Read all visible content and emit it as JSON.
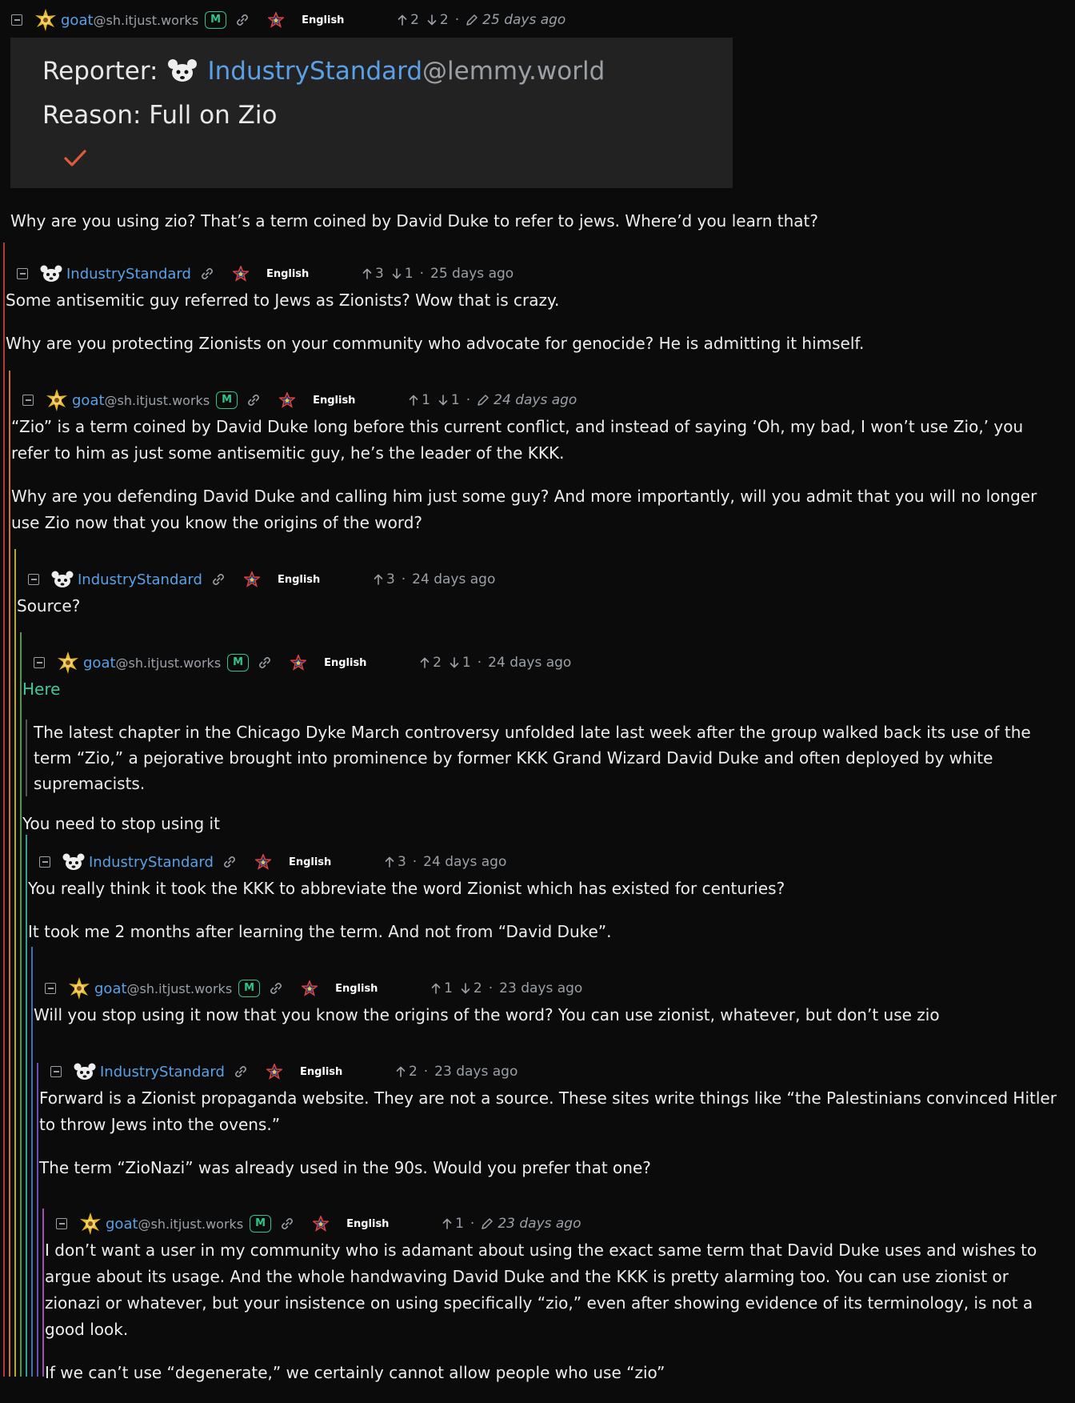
{
  "report": {
    "reporter_label": "Reporter:",
    "reporter_name": "IndustryStandard",
    "reporter_instance": "@lemmy.world",
    "reason": "Reason: Full on Zio"
  },
  "comments": [
    {
      "user": "goat",
      "instance": "@sh.itjust.works",
      "mod": "M",
      "lang": "English",
      "up": "2",
      "down": "2",
      "time": "25 days ago",
      "edited": true,
      "paras": [
        "Why are you using zio? That’s a term coined by David Duke to refer to jews. Where’d you learn that?"
      ]
    },
    {
      "user": "IndustryStandard",
      "instance": "",
      "mod": "",
      "lang": "English",
      "up": "3",
      "down": "1",
      "time": "25 days ago",
      "edited": false,
      "paras": [
        "Some antisemitic guy referred to Jews as Zionists? Wow that is crazy.",
        "Why are you protecting Zionists on your community who advocate for genocide? He is admitting it himself."
      ]
    },
    {
      "user": "goat",
      "instance": "@sh.itjust.works",
      "mod": "M",
      "lang": "English",
      "up": "1",
      "down": "1",
      "time": "24 days ago",
      "edited": true,
      "paras": [
        "“Zio” is a term coined by David Duke long before this current conflict, and instead of saying ‘Oh, my bad, I won’t use Zio,’ you refer to him as just some antisemitic guy, he’s the leader of the KKK.",
        "Why are you defending David Duke and calling him just some guy? And more importantly, will you admit that you will no longer use Zio now that you know the origins of the word?"
      ]
    },
    {
      "user": "IndustryStandard",
      "instance": "",
      "mod": "",
      "lang": "English",
      "up": "3",
      "down": "",
      "time": "24 days ago",
      "edited": false,
      "paras": [
        "Source?"
      ]
    },
    {
      "user": "goat",
      "instance": "@sh.itjust.works",
      "mod": "M",
      "lang": "English",
      "up": "2",
      "down": "1",
      "time": "24 days ago",
      "edited": false,
      "link": "Here",
      "quote": "The latest chapter in the Chicago Dyke March controversy unfolded late last week after the group walked back its use of the term “Zio,” a pejorative brought into prominence by former KKK Grand Wizard David Duke and often deployed by white supremacists.",
      "paras": [
        "You need to stop using it"
      ]
    },
    {
      "user": "IndustryStandard",
      "instance": "",
      "mod": "",
      "lang": "English",
      "up": "3",
      "down": "",
      "time": "24 days ago",
      "edited": false,
      "paras": [
        "You really think it took the KKK to abbreviate the word Zionist which has existed for centuries?",
        "It took me 2 months after learning the term. And not from “David Duke”."
      ]
    },
    {
      "user": "goat",
      "instance": "@sh.itjust.works",
      "mod": "M",
      "lang": "English",
      "up": "1",
      "down": "2",
      "time": "23 days ago",
      "edited": false,
      "paras": [
        "Will you stop using it now that you know the origins of the word? You can use zionist, whatever, but don’t use zio"
      ]
    },
    {
      "user": "IndustryStandard",
      "instance": "",
      "mod": "",
      "lang": "English",
      "up": "2",
      "down": "",
      "time": "23 days ago",
      "edited": false,
      "paras": [
        "Forward is a Zionist propaganda website. They are not a source. These sites write things like “the Palestinians convinced Hitler to throw Jews into the ovens.”",
        "The term “ZioNazi” was already used in the 90s. Would you prefer that one?"
      ]
    },
    {
      "user": "goat",
      "instance": "@sh.itjust.works",
      "mod": "M",
      "lang": "English",
      "up": "1",
      "down": "",
      "time": "23 days ago",
      "edited": true,
      "paras": [
        "I don’t want a user in my community who is adamant about using the exact same term that David Duke uses and wishes to argue about its usage. And the whole handwaving David Duke and the KKK is pretty alarming too. You can use zionist or zionazi or whatever, but your insistence on using specifically “zio,” even after showing evidence of its terminology, is not a good look.",
        "If we can’t use “degenerate,” we certainly cannot allow people who use “zio”"
      ]
    }
  ],
  "colors": {
    "rails": [
      "#b33a3a",
      "#c9742c",
      "#b7a73a",
      "#4f9a45",
      "#3b9a8f",
      "#3f70b8",
      "#6a4fb8",
      "#a14fb3"
    ]
  }
}
